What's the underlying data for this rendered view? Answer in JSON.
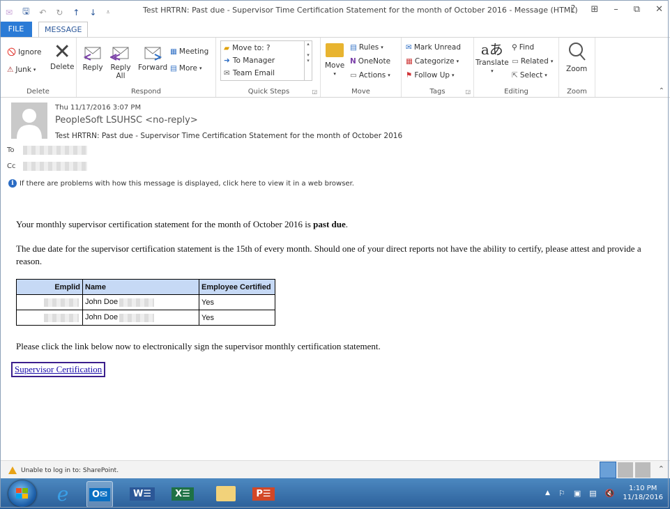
{
  "window": {
    "title": "Test HRTRN:  Past due - Supervisor Time Certification Statement for the month of October 2016 - Message (HTML)",
    "controls": [
      "?",
      "⊞",
      "–",
      "⧉",
      "✕"
    ]
  },
  "tabs": {
    "file": "FILE",
    "message": "MESSAGE"
  },
  "ribbon": {
    "delete_group": {
      "label": "Delete",
      "ignore": "Ignore",
      "junk": "Junk",
      "delete": "Delete"
    },
    "respond_group": {
      "label": "Respond",
      "reply": "Reply",
      "reply_all_1": "Reply",
      "reply_all_2": "All",
      "forward": "Forward",
      "meeting": "Meeting",
      "more": "More"
    },
    "quicksteps_group": {
      "label": "Quick Steps",
      "items": [
        "Move to: ?",
        "To Manager",
        "Team Email"
      ]
    },
    "move_group": {
      "label": "Move",
      "move": "Move",
      "rules": "Rules",
      "onenote": "OneNote",
      "actions": "Actions"
    },
    "tags_group": {
      "label": "Tags",
      "mark_unread": "Mark Unread",
      "categorize": "Categorize",
      "follow_up": "Follow Up"
    },
    "editing_group": {
      "label": "Editing",
      "translate": "Translate",
      "find": "Find",
      "related": "Related",
      "select": "Select"
    },
    "zoom_group": {
      "label": "Zoom",
      "zoom": "Zoom"
    }
  },
  "header": {
    "date": "Thu 11/17/2016 3:07 PM",
    "from": "PeopleSoft LSUHSC <no-reply>",
    "subject": "Test HRTRN:  Past due - Supervisor Time Certification Statement for the month of October 2016",
    "to_label": "To",
    "cc_label": "Cc",
    "info_text": "If there are problems with how this message is displayed, click here to view it in a web browser."
  },
  "body": {
    "p1_text": "Your monthly supervisor certification statement for the month of October 2016 is ",
    "p1_bold": "past due",
    "p1_end": ".",
    "p2": "The due date for the supervisor certification statement is the 15th of every month. Should one of your direct reports not have the ability to certify, please attest and provide a reason.",
    "table": {
      "headers": [
        "Emplid",
        "Name",
        "Employee Certified"
      ],
      "rows": [
        {
          "name": "John Doe",
          "certified": "Yes"
        },
        {
          "name": "John Doe",
          "certified": "Yes"
        }
      ]
    },
    "p3": "Please click the link below now to electronically sign the supervisor monthly certification statement.",
    "link": "Supervisor Certification"
  },
  "status": {
    "text": "Unable to log in to: SharePoint."
  },
  "taskbar": {
    "time": "1:10 PM",
    "date": "11/18/2016"
  }
}
